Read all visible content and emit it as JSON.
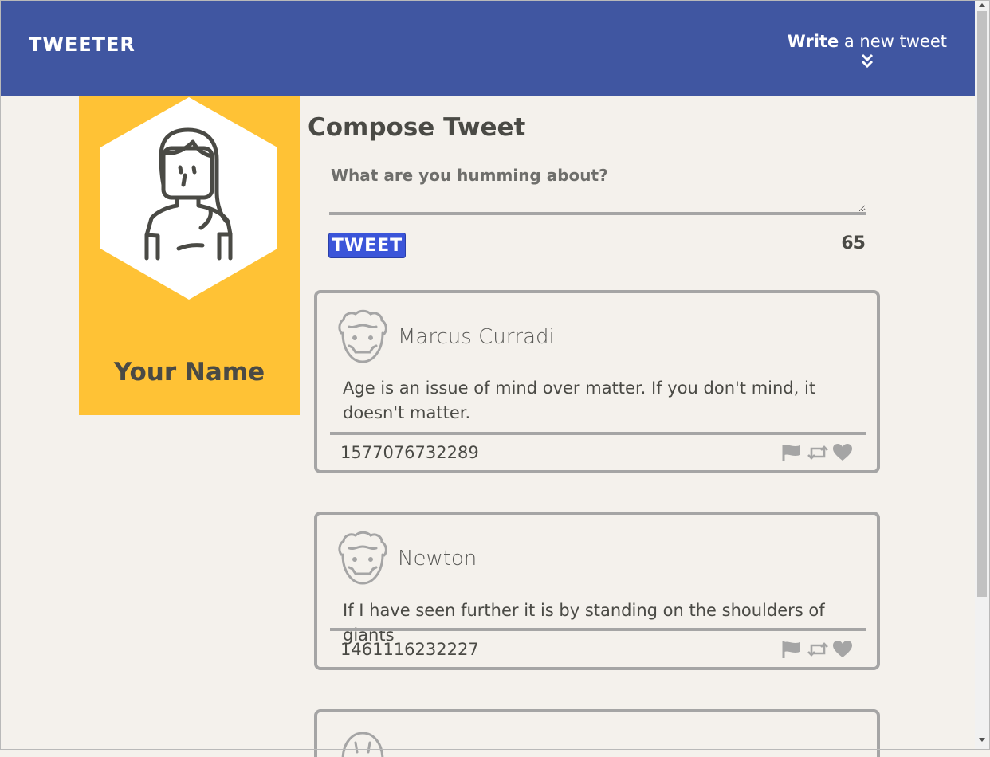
{
  "header": {
    "brand": "TWEETER",
    "write_bold": "Write",
    "write_rest": " a new tweet"
  },
  "profile": {
    "name": "Your Name"
  },
  "compose": {
    "title": "Compose Tweet",
    "placeholder": "What are you humming about?",
    "button_label": "TWEET",
    "counter": "65"
  },
  "tweets": [
    {
      "author": "Marcus Curradi",
      "content": "Age is an issue of mind over matter. If you don't mind, it doesn't matter.",
      "timestamp": "1577076732289"
    },
    {
      "author": "Newton",
      "content": "If I have seen further it is by standing on the shoulders of giants",
      "timestamp": "1461116232227"
    }
  ],
  "colors": {
    "header": "#4056a1",
    "profile": "#ffc235",
    "button": "#3b55d9",
    "background": "#f4f1ec",
    "border": "#a5a5a5"
  },
  "icons": [
    "flag-icon",
    "retweet-icon",
    "heart-icon",
    "double-chevron-down-icon"
  ]
}
